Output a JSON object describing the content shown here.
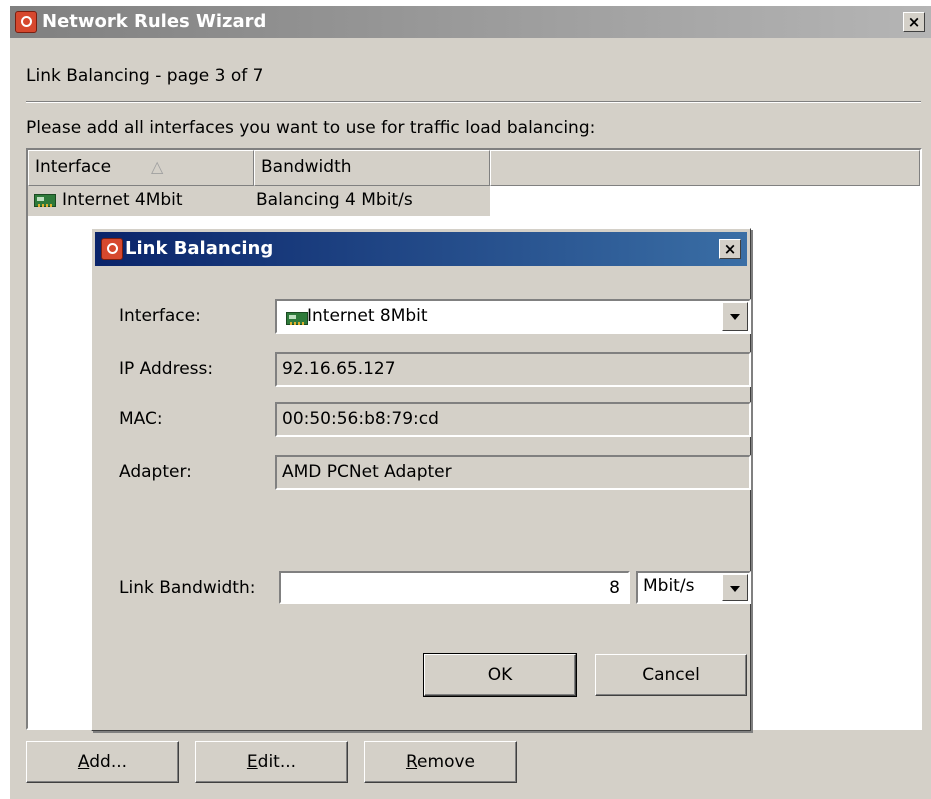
{
  "window": {
    "title": "Network Rules Wizard",
    "page_subtitle": "Link Balancing - page 3 of 7",
    "instruction": "Please add all interfaces you want to use for traffic load balancing:",
    "close_glyph": "×"
  },
  "list": {
    "columns": [
      "Interface",
      "Bandwidth"
    ],
    "sort_glyph": "△",
    "rows": [
      {
        "interface": "Internet 4Mbit",
        "bandwidth": "Balancing 4 Mbit/s",
        "icon": "network-card-icon"
      }
    ]
  },
  "buttons": {
    "add": {
      "label": "Add...",
      "mnemonic": "A",
      "rest": "dd..."
    },
    "edit": {
      "label": "Edit...",
      "mnemonic": "E",
      "rest": "dit..."
    },
    "remove": {
      "label": "Remove",
      "mnemonic": "R",
      "rest": "emove"
    }
  },
  "dialog": {
    "title": "Link Balancing",
    "close_glyph": "×",
    "interface_label": "Interface:",
    "interface_value": "Internet 8Mbit",
    "ip_label": "IP Address:",
    "ip_value": "92.16.65.127",
    "mac_label": "MAC:",
    "mac_value": "00:50:56:b8:79:cd",
    "adapter_label": "Adapter:",
    "adapter_value": "AMD PCNet Adapter",
    "bandwidth_label": "Link Bandwidth:",
    "bandwidth_value": "8",
    "bandwidth_unit": "Mbit/s",
    "ok_label": "OK",
    "cancel_label": "Cancel"
  },
  "colors": {
    "face": "#d4d0c8",
    "inactive_title": "#808080",
    "active_title": "#0a246a",
    "app_icon": "#d6482e"
  }
}
